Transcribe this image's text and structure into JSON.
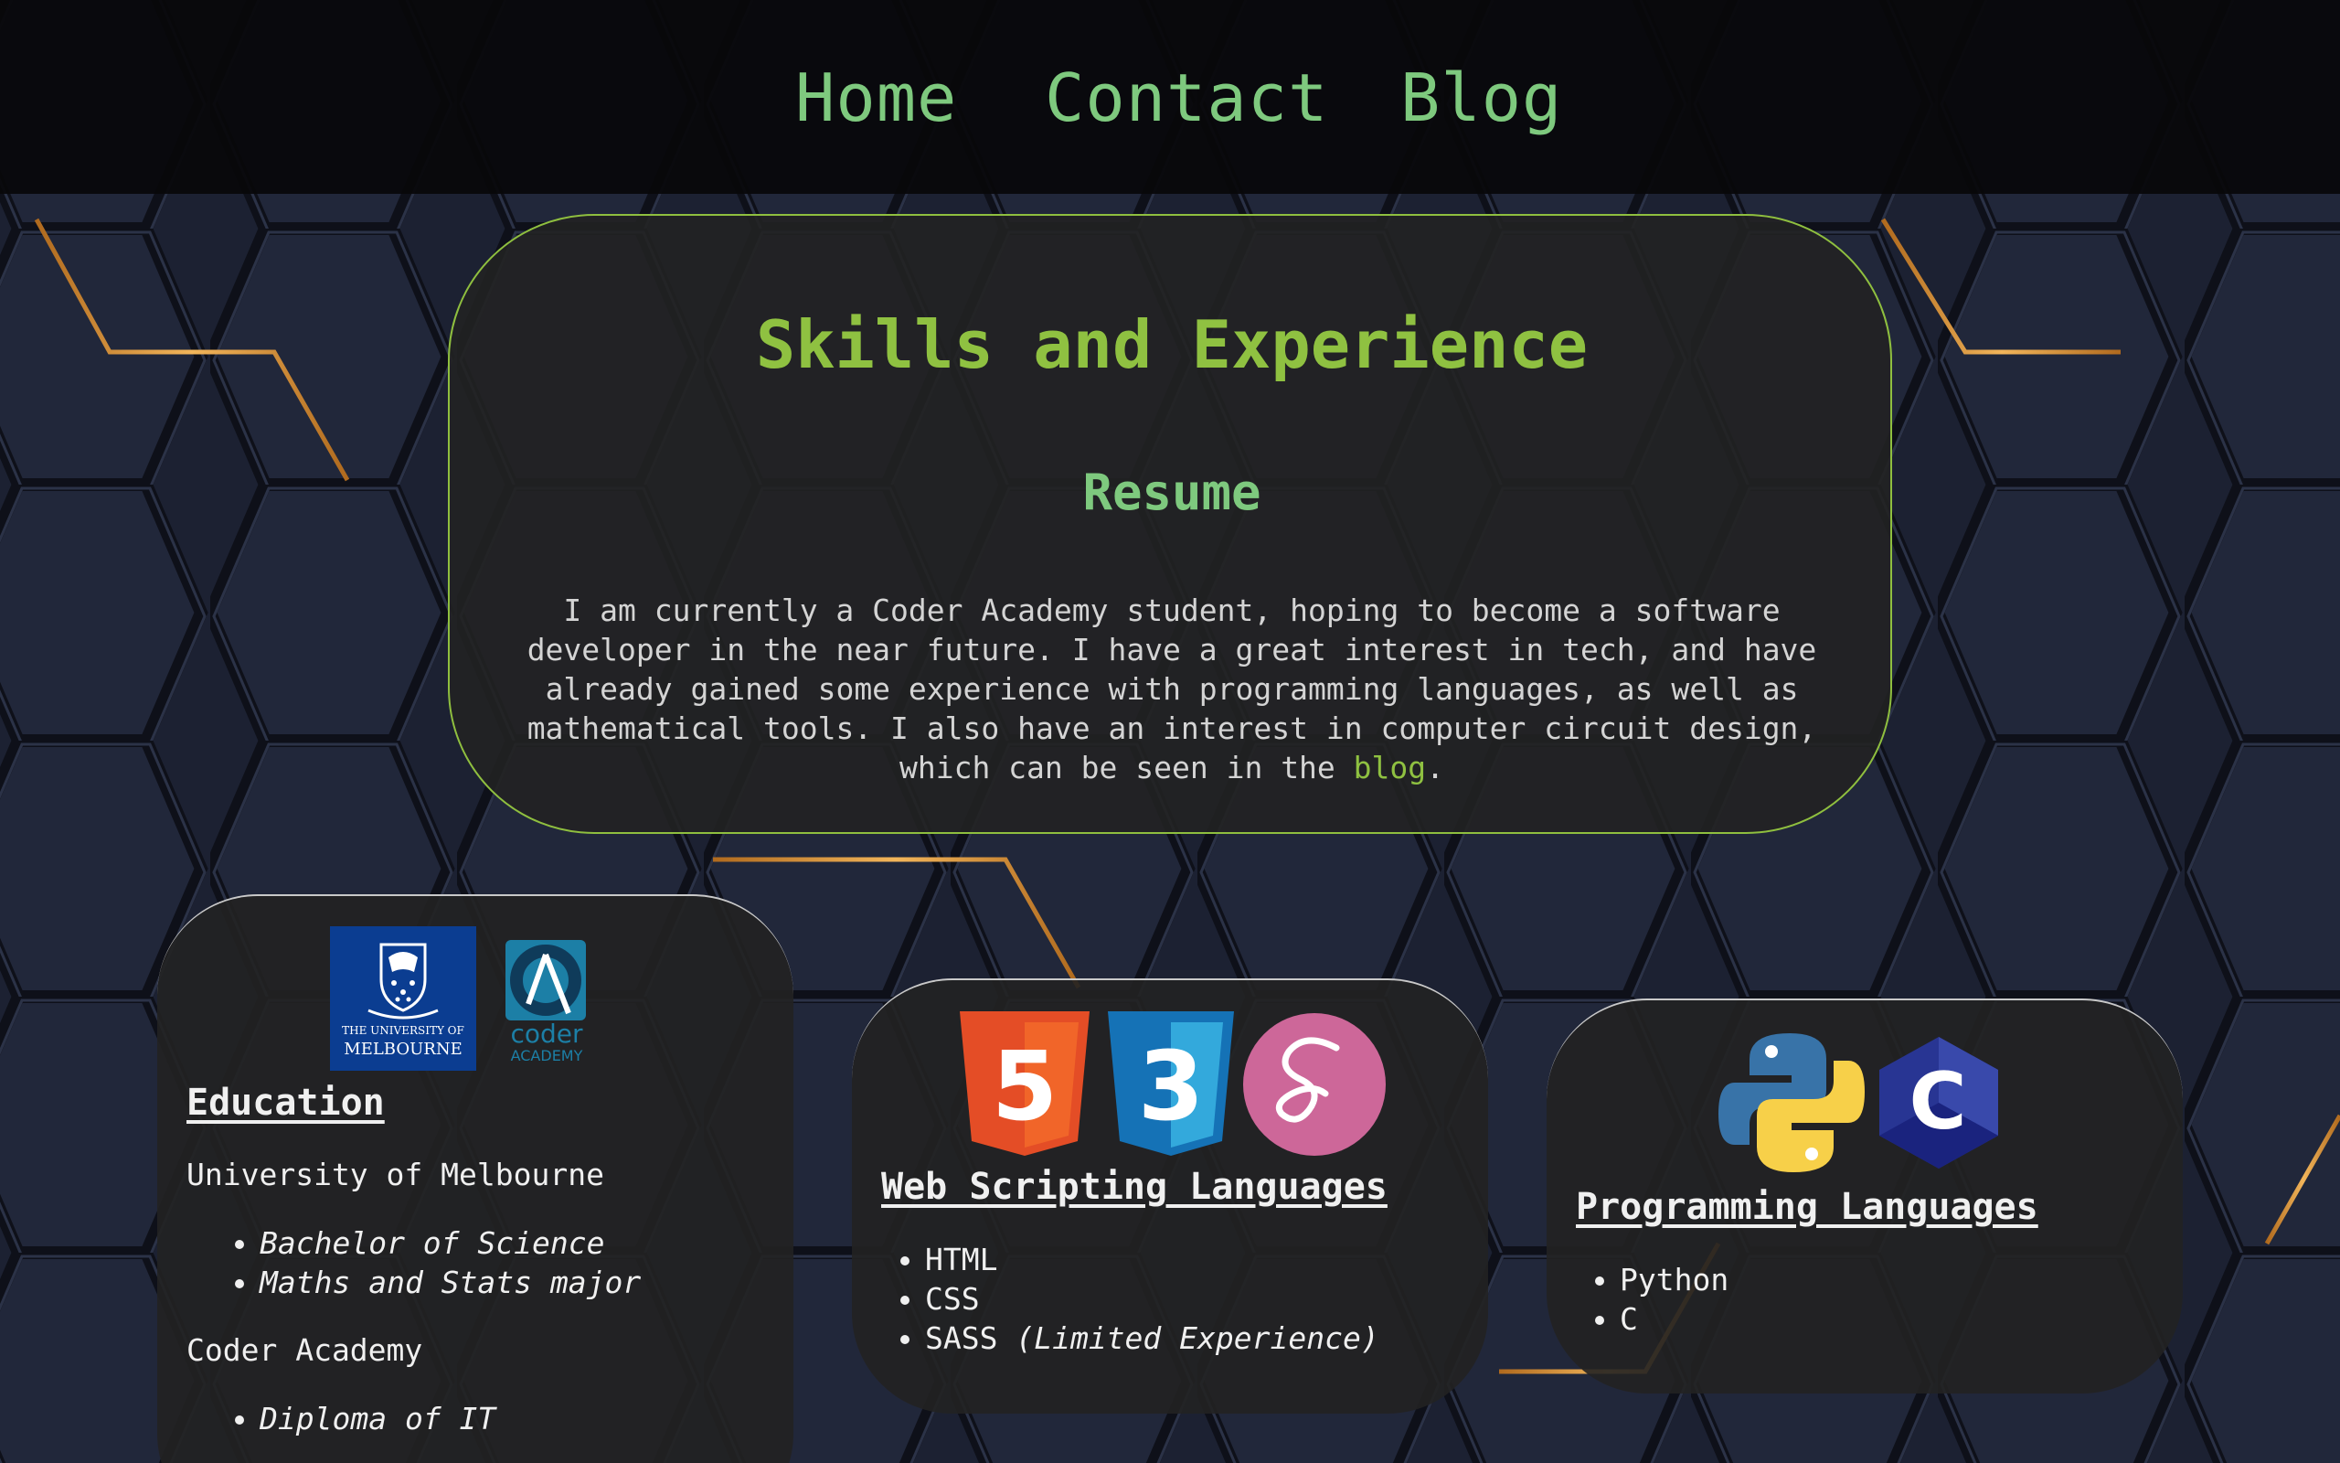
{
  "nav": {
    "home": "Home",
    "contact": "Contact",
    "blog": "Blog"
  },
  "main": {
    "title": "Skills and Experience",
    "subtitle": "Resume",
    "intro_text": "I am currently a Coder Academy student, hoping to become a software developer in the near future. I have a great interest in tech, and have already gained some experience with programming languages, as well as mathematical tools. I also have an interest in computer circuit design, which can be seen in the ",
    "intro_link": "blog",
    "intro_end": "."
  },
  "education": {
    "heading": "Education",
    "uni_logo": {
      "line1": "THE UNIVERSITY OF",
      "line2": "MELBOURNE"
    },
    "coder_logo": {
      "line1": "coder",
      "line2": "ACADEMY"
    },
    "school1": "University of Melbourne",
    "school1_items": [
      "Bachelor of Science",
      "Maths and Stats major"
    ],
    "school2": "Coder Academy",
    "school2_items": [
      "Diploma of IT"
    ]
  },
  "web": {
    "heading": "Web Scripting Languages",
    "html_badge": "5",
    "css_badge": "3",
    "items": [
      "HTML",
      "CSS",
      "SASS "
    ],
    "sass_note": "(Limited Experience)"
  },
  "prog": {
    "heading": "Programming Languages",
    "c_badge": "C",
    "items": [
      "Python",
      "C"
    ]
  },
  "colors": {
    "accent_green": "#8fc141",
    "nav_green": "#7ec97e",
    "background": "#1b1f2e",
    "gold_edge": "#d9963c"
  }
}
